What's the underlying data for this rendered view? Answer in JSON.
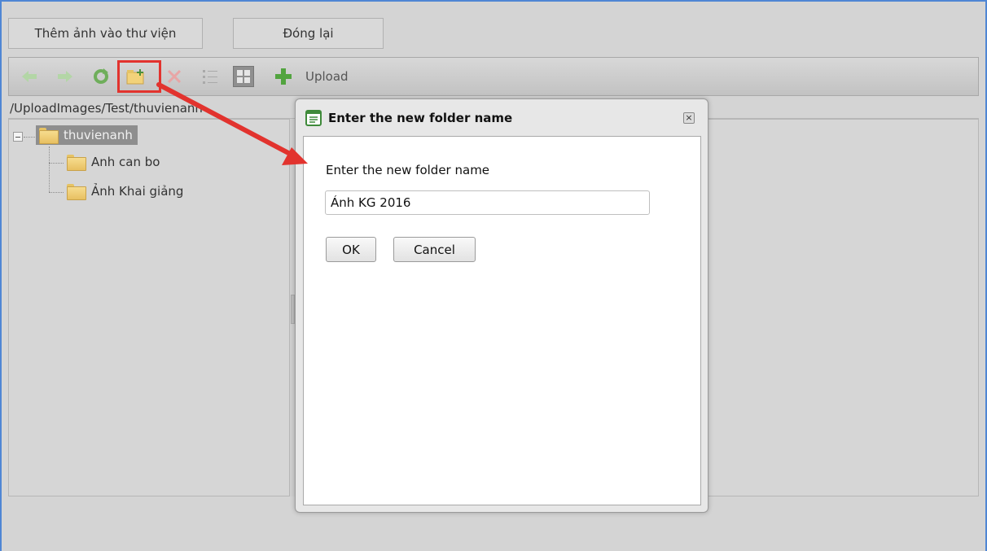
{
  "top_buttons": {
    "add_to_library": "Thêm ảnh vào thư viện",
    "close": "Đóng lại"
  },
  "toolbar": {
    "icons": [
      "back-arrow-icon",
      "forward-arrow-icon",
      "refresh-icon",
      "new-folder-icon",
      "delete-icon",
      "list-view-icon",
      "thumbnail-view-icon",
      "add-icon"
    ],
    "upload_label": "Upload"
  },
  "path": "/UploadImages/Test/thuvienanh",
  "tree": {
    "root": "thuvienanh",
    "children": [
      "Anh can bo",
      "Ảnh Khai giảng"
    ]
  },
  "dialog": {
    "title": "Enter the new folder name",
    "prompt": "Enter the new folder name",
    "input_value": "Ảnh KG 2016",
    "ok_label": "OK",
    "cancel_label": "Cancel"
  },
  "colors": {
    "annotation_red": "#e2332e",
    "frame_blue": "#4f86d4",
    "selected_node": "#8e8e8e"
  }
}
